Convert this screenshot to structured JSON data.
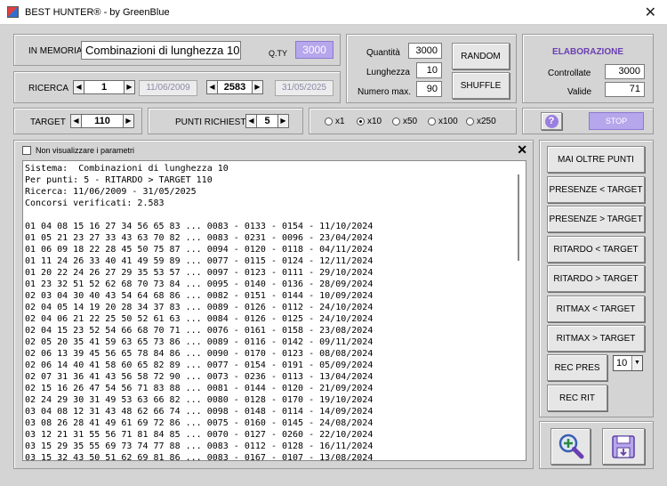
{
  "window": {
    "title": "BEST HUNTER® - by GreenBlue",
    "close": "✕"
  },
  "memoria": {
    "label": "IN MEMORIA",
    "value": "Combinazioni di lunghezza 10",
    "qty_label": "Q.TY",
    "qty_value": "3000"
  },
  "ricerca": {
    "label": "RICERCA",
    "start_index": "1",
    "start_date": "11/06/2009",
    "end_index": "2583",
    "end_date": "31/05/2025"
  },
  "params": {
    "quantita_label": "Quantità",
    "quantita": "3000",
    "lunghezza_label": "Lunghezza",
    "lunghezza": "10",
    "numero_max_label": "Numero max.",
    "numero_max": "90",
    "random": "RANDOM",
    "shuffle": "SHUFFLE"
  },
  "elaborazione": {
    "title": "ELABORAZIONE",
    "controllate_label": "Controllate",
    "controllate": "3000",
    "valide_label": "Valide",
    "valide": "71"
  },
  "target": {
    "label": "TARGET",
    "value": "110"
  },
  "punti": {
    "label": "PUNTI RICHIESTI",
    "value": "5"
  },
  "multipliers": {
    "options": [
      "x1",
      "x10",
      "x50",
      "x100",
      "x250"
    ],
    "selected": "x10"
  },
  "help": "?",
  "stop": "STOP",
  "output": {
    "hide_params_label": "Non visualizzare i parametri",
    "close": "✕",
    "lines": [
      "Sistema:  Combinazioni di lunghezza 10",
      "Per punti: 5 - RITARDO > TARGET 110",
      "Ricerca: 11/06/2009 - 31/05/2025",
      "Concorsi verificati: 2.583",
      "",
      "01 04 08 15 16 27 34 56 65 83 ... 0083 - 0133 - 0154 - 11/10/2024",
      "01 05 21 23 27 33 43 63 70 82 ... 0083 - 0231 - 0096 - 23/04/2024",
      "01 06 09 18 22 28 45 50 75 87 ... 0094 - 0120 - 0118 - 04/11/2024",
      "01 11 24 26 33 40 41 49 59 89 ... 0077 - 0115 - 0124 - 12/11/2024",
      "01 20 22 24 26 27 29 35 53 57 ... 0097 - 0123 - 0111 - 29/10/2024",
      "01 23 32 51 52 62 68 70 73 84 ... 0095 - 0140 - 0136 - 28/09/2024",
      "02 03 04 30 40 43 54 64 68 86 ... 0082 - 0151 - 0144 - 10/09/2024",
      "02 04 05 14 19 20 28 34 37 83 ... 0089 - 0126 - 0112 - 24/10/2024",
      "02 04 06 21 22 25 50 52 61 63 ... 0084 - 0126 - 0125 - 24/10/2024",
      "02 04 15 23 52 54 66 68 70 71 ... 0076 - 0161 - 0158 - 23/08/2024",
      "02 05 20 35 41 59 63 65 73 86 ... 0089 - 0116 - 0142 - 09/11/2024",
      "02 06 13 39 45 56 65 78 84 86 ... 0090 - 0170 - 0123 - 08/08/2024",
      "02 06 14 40 41 58 60 65 82 89 ... 0077 - 0154 - 0191 - 05/09/2024",
      "02 07 31 36 41 43 56 58 72 90 ... 0073 - 0236 - 0113 - 13/04/2024",
      "02 15 16 26 47 54 56 71 83 88 ... 0081 - 0144 - 0120 - 21/09/2024",
      "02 24 29 30 31 49 53 63 66 82 ... 0080 - 0128 - 0170 - 19/10/2024",
      "03 04 08 12 31 43 48 62 66 74 ... 0098 - 0148 - 0114 - 14/09/2024",
      "03 08 26 28 41 49 61 69 72 86 ... 0075 - 0160 - 0145 - 24/08/2024",
      "03 12 21 31 55 56 71 81 84 85 ... 0070 - 0127 - 0260 - 22/10/2024",
      "03 15 29 35 55 69 73 74 77 88 ... 0083 - 0112 - 0128 - 16/11/2024",
      "03 15 32 43 50 51 62 69 81 86 ... 0083 - 0167 - 0107 - 13/08/2024"
    ]
  },
  "side_buttons": {
    "mai_oltre_punti": "MAI OLTRE PUNTI",
    "presenze_lt_target": "PRESENZE < TARGET",
    "presenze_gt_target": "PRESENZE > TARGET",
    "ritardo_lt_target": "RITARDO < TARGET",
    "ritardo_gt_target": "RITARDO > TARGET",
    "ritmax_lt_target": "RITMAX < TARGET",
    "ritmax_gt_target": "RITMAX > TARGET",
    "rec_pres": "REC PRES",
    "rec_rit": "REC RIT",
    "rec_value": "10"
  },
  "icons": {
    "zoom": "magnifier-plus-icon",
    "save": "floppy-disk-icon"
  },
  "colors": {
    "accent_purple": "#6a3fb0",
    "lavender": "#b6a6ec",
    "field_disabled": "#8a8aa8"
  }
}
